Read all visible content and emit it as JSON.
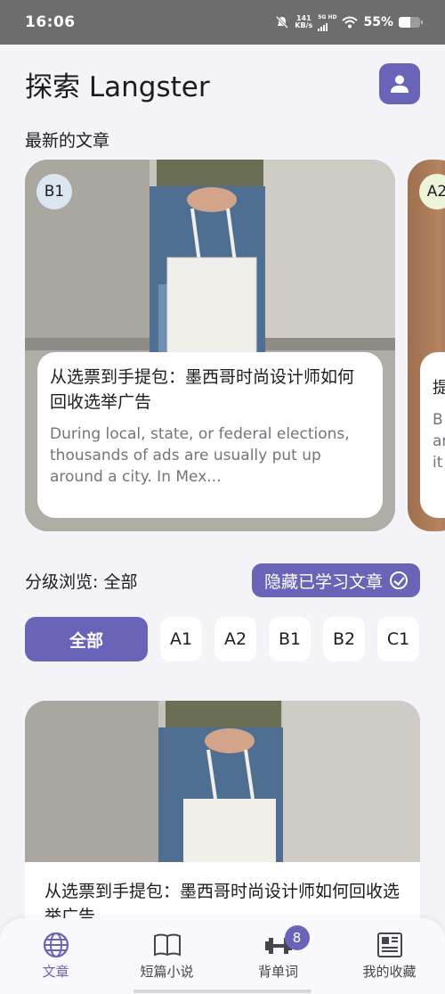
{
  "status_bar": {
    "time": "16:06",
    "net_speed": "141",
    "net_unit": "KB/s",
    "signal_label": "5G HD",
    "battery": "55%"
  },
  "header": {
    "title": "探索 Langster",
    "profile_icon": "person-icon"
  },
  "latest_section": {
    "label": "最新的文章"
  },
  "carousel": [
    {
      "level": "B1",
      "title": "从选票到手提包：墨西哥时尚设计师如何回收选举广告",
      "snippet": "During local, state, or federal elections, thousands of ads are usually put up around a city. In Mex..."
    },
    {
      "level": "A2",
      "title": "提",
      "snippet": "B\nar\nit"
    }
  ],
  "filter": {
    "label": "分级浏览: 全部",
    "hide_button": "隐藏已学习文章"
  },
  "levels": [
    "全部",
    "A1",
    "A2",
    "B1",
    "B2",
    "C1"
  ],
  "article_list": [
    {
      "title": "从选票到手提包：墨西哥时尚设计师如何回收选举广告"
    }
  ],
  "bottom_nav": {
    "items": [
      {
        "label": "文章",
        "icon": "globe-icon",
        "active": true
      },
      {
        "label": "短篇小说",
        "icon": "book-icon",
        "active": false
      },
      {
        "label": "背单词",
        "icon": "dumbbell-icon",
        "active": false,
        "badge": "8"
      },
      {
        "label": "我的收藏",
        "icon": "newspaper-icon",
        "active": false
      }
    ]
  },
  "colors": {
    "accent": "#6a64b9",
    "background": "#f4f3f8",
    "badge_b1": "#dbe6f1",
    "badge_a2": "#ecf5d7"
  }
}
